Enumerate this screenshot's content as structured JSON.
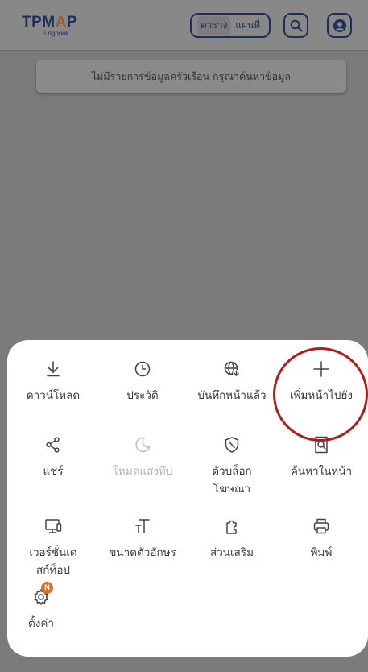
{
  "app": {
    "logo_main_left": "TPM",
    "logo_main_accent": "A",
    "logo_main_right": "P",
    "logo_sub": "Logbook",
    "view_toggle": {
      "table": "ตาราง",
      "map": "แผนที่"
    },
    "notice": "ไม่มีรายการข้อมูลครัวเรือน กรุณาค้นหาข้อมูล"
  },
  "menu": {
    "download": "ดาวน์โหลด",
    "history": "ประวัติ",
    "saved_pages": "บันทึกหน้าแล้ว",
    "add_page_to": "เพิ่มหน้าไปยัง",
    "share": "แชร์",
    "dark_mode": "โหมดแสงทึบ",
    "ad_blocker": "ตัวบล็อกโฆษณา",
    "find_in_page": "ค้นหาในหน้า",
    "desktop_version": "เวอร์ชั่นเดสก์ท็อป",
    "text_size": "ขนาดตัวอักษร",
    "add_ons": "ส่วนเสริม",
    "print": "พิมพ์",
    "settings": "ตั้งค่า",
    "settings_badge": "N"
  },
  "icons": {
    "download": "download-icon",
    "history": "clock-icon",
    "saved_pages": "globe-save-icon",
    "add_page_to": "plus-icon",
    "share": "share-icon",
    "dark_mode": "moon-icon",
    "ad_blocker": "shield-icon",
    "find_in_page": "page-search-icon",
    "desktop_version": "desktop-icon",
    "text_size": "text-size-icon",
    "add_ons": "puzzle-icon",
    "print": "printer-icon",
    "settings": "gear-icon"
  },
  "colors": {
    "overlay_dim": "#7b7b7b",
    "brand_navy": "#1c2f5a",
    "highlight_ring": "#b01c1c",
    "badge": "#e0701c",
    "menu_text": "#3a3a3a",
    "disabled_text": "#b5b5b5"
  }
}
